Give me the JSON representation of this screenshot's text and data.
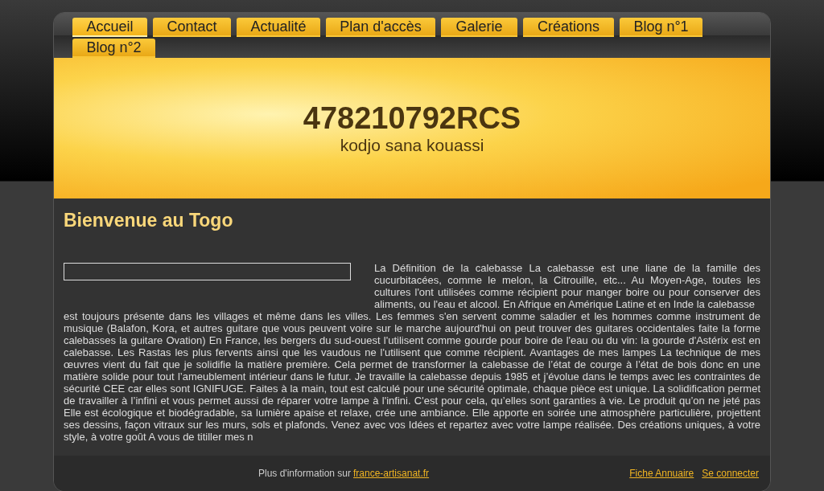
{
  "nav": [
    {
      "label": "Accueil",
      "selected": true
    },
    {
      "label": "Contact",
      "selected": false
    },
    {
      "label": "Actualité",
      "selected": false
    },
    {
      "label": "Plan d'accès",
      "selected": false
    },
    {
      "label": "Galerie",
      "selected": false
    },
    {
      "label": "Créations",
      "selected": false
    },
    {
      "label": "Blog n°1",
      "selected": false
    },
    {
      "label": "Blog n°2",
      "selected": false
    }
  ],
  "header": {
    "title": "478210792RCS",
    "subtitle": "kodjo sana kouassi"
  },
  "content": {
    "heading": "Bienvenue au Togo",
    "text_beside": "La Définition de la calebasse La calebasse est une liane de la famille des cucurbitacées, comme le melon, la Citrouille, etc... Au Moyen-Age, toutes les cultures l'ont utilisées comme récipient pour manger boire ou pour conserver des aliments, ou l'eau et alcool. En Afrique en Amérique Latine et en Inde la calebasse",
    "text_below": "est toujours présente dans les villages et même dans les villes. Les femmes s'en servent comme saladier et les hommes comme instrument de musique (Balafon, Kora, et autres guitare que vous peuvent voire sur le marche aujourd'hui on peut trouver des guitares occidentales faite la forme calebasses la guitare Ovation) En France, les bergers du sud-ouest l'utilisent comme gourde pour boire de l'eau ou du vin: la gourde d'Astérix est en calebasse. Les Rastas les plus fervents ainsi que les vaudous ne l'utilisent que comme récipient. Avantages de mes lampes La technique de mes œuvres vient du fait que je solidifie la matière première. Cela permet de transformer la calebasse de l’état de courge à l’état de bois donc en une matière solide pour tout l’ameublement intérieur dans le futur. Je travaille la calebasse depuis 1985 et j’évolue dans le temps avec les contraintes de sécurité CEE car elles sont IGNIFUGE. Faites à la main, tout est calculé pour une sécurité optimale, chaque pièce est unique. La solidification permet de travailler à l’infini et vous permet aussi de réparer votre lampe à l'infini. C'est pour cela, qu’elles sont garanties à vie. Le produit qu’on ne jeté pas Elle est écologique et biodégradable, sa lumière apaise et relaxe, crée une ambiance. Elle apporte en soirée une atmosphère particulière, projettent ses dessins, façon vitraux sur les murs, sols et plafonds. Venez avec vos Idées et repartez avec votre lampe réalisée. Des créations uniques, à votre style, à votre goût A vous de titiller mes n"
  },
  "footer": {
    "info": "Plus d'information sur",
    "info_link": "france-artisanat.fr",
    "links": [
      "Fiche Annuaire",
      "Se connecter"
    ]
  }
}
